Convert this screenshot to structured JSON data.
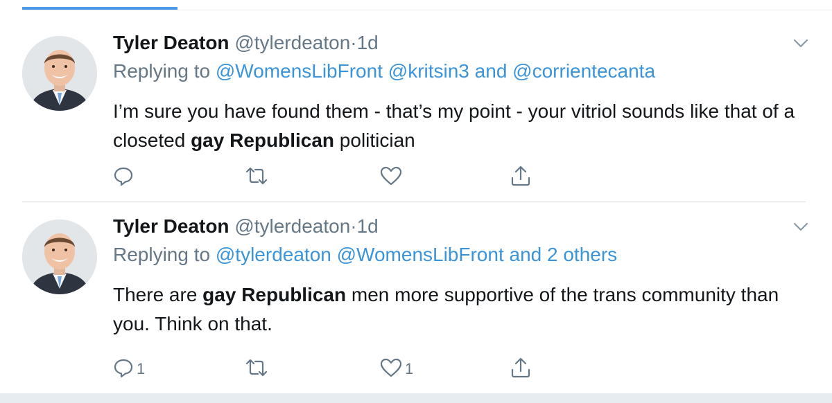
{
  "tweets": [
    {
      "display_name": "Tyler Deaton",
      "handle": "@tylerdeaton",
      "separator": "·",
      "time": "1d",
      "reply_prefix": "Replying to",
      "reply_part1": "@WomensLibFront",
      "reply_part2": "@kritsin3",
      "reply_and": "and",
      "reply_part3": "@corrientecanta",
      "text_segments": [
        "I’m sure you have found them - that’s my point - your vitriol sounds like that of a closeted ",
        "gay Republican",
        " politician"
      ],
      "reply_count": "",
      "like_count": ""
    },
    {
      "display_name": "Tyler Deaton",
      "handle": "@tylerdeaton",
      "separator": "·",
      "time": "1d",
      "reply_prefix": "Replying to",
      "reply_part1": "@tylerdeaton",
      "reply_part2": "@WomensLibFront",
      "reply_and": "and 2 others",
      "text_segments": [
        "There are ",
        "gay Republican",
        " men more supportive of the trans community than you. Think on that."
      ],
      "reply_count": "1",
      "like_count": "1"
    }
  ],
  "icons": {
    "reply": "reply-icon",
    "retweet": "retweet-icon",
    "like": "heart-icon",
    "share": "share-icon",
    "more": "chevron-down-icon"
  },
  "colors": {
    "link": "#3b94d9",
    "muted": "#657786",
    "accent": "#4a99e9"
  }
}
